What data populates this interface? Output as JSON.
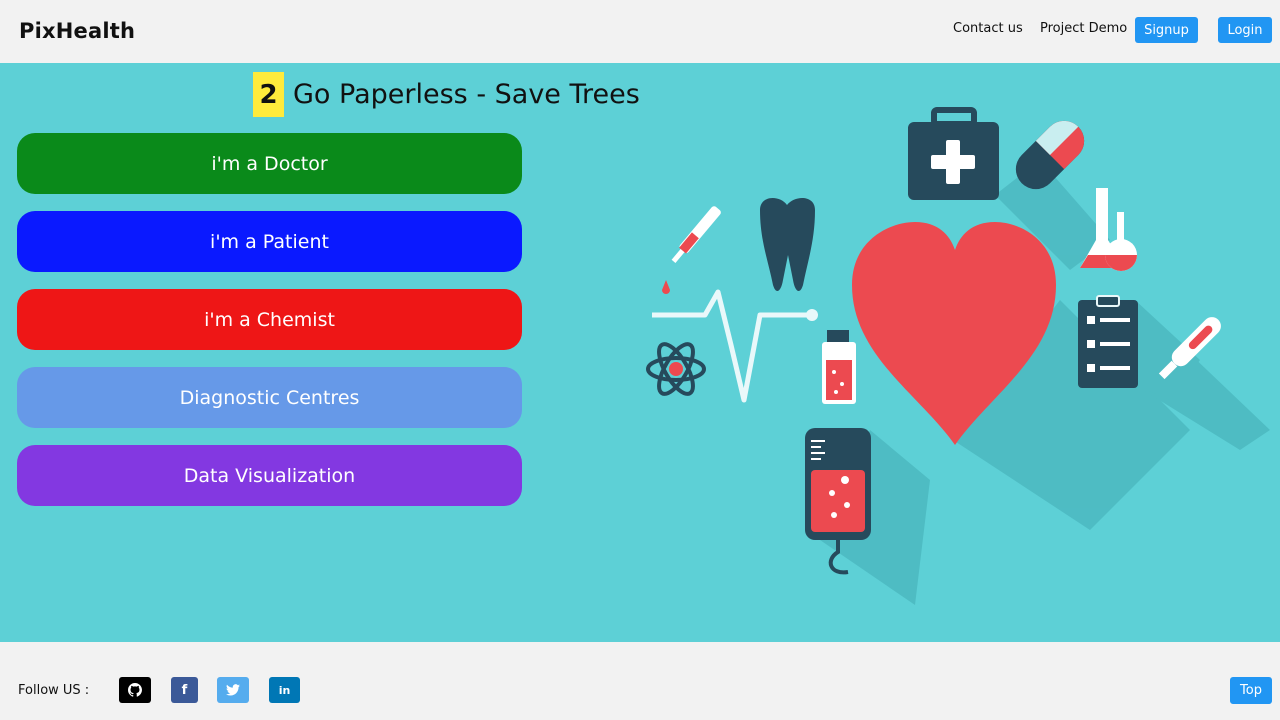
{
  "navbar": {
    "brand": "PixHealth",
    "contact_label": "Contact us",
    "demo_label": "Project Demo",
    "signup_label": "Signup",
    "login_label": "Login"
  },
  "main": {
    "tagline_number": "2",
    "tagline_text": "Go Paperless - Save Trees",
    "roles": [
      {
        "label": "i'm a Doctor",
        "color": "#0a8a1a"
      },
      {
        "label": "i'm a Patient",
        "color": "#0a19ff"
      },
      {
        "label": "i'm a Chemist",
        "color": "#ee1616"
      },
      {
        "label": "Diagnostic Centres",
        "color": "#6699e8"
      },
      {
        "label": "Data Visualization",
        "color": "#8338e1"
      }
    ]
  },
  "footer": {
    "follow_label": "Follow US :",
    "social": [
      "github-icon",
      "facebook-icon",
      "twitter-icon",
      "linkedin-icon"
    ],
    "top_label": "Top"
  },
  "colors": {
    "accent": "#2196f3",
    "main_bg": "#5dd0d6",
    "highlight": "#ffeb3b"
  }
}
